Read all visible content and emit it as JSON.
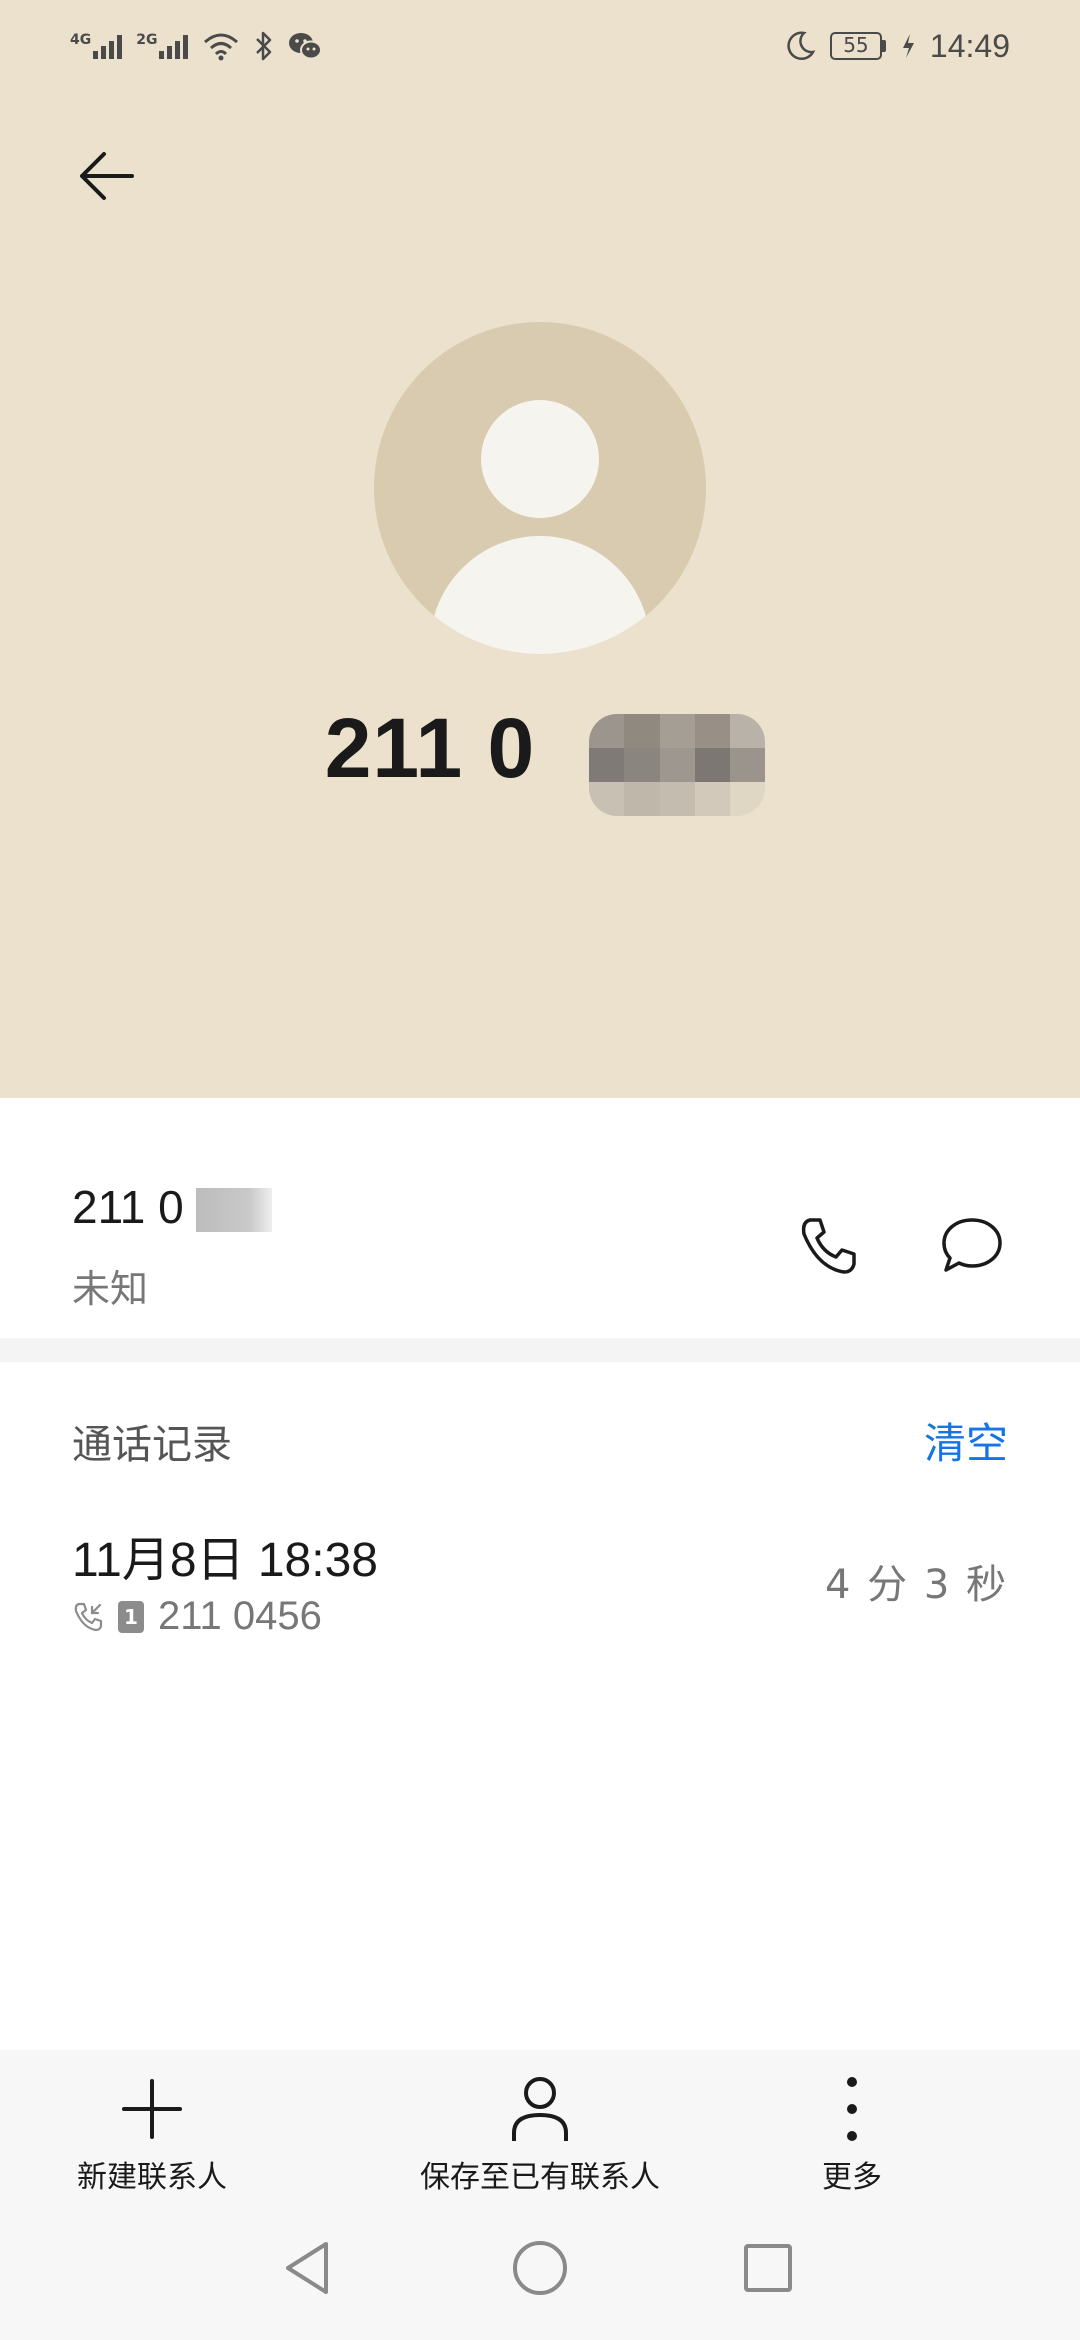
{
  "status_bar": {
    "net1": "4G",
    "net2": "2G",
    "battery": "55",
    "time": "14:49"
  },
  "header": {
    "number_visible": "211 0"
  },
  "contact": {
    "number_visible": "211 0",
    "label": "未知"
  },
  "call_log": {
    "title": "通话记录",
    "clear_label": "清空",
    "items": [
      {
        "datetime": "11月8日 18:38",
        "sim": "1",
        "number": "211 0456",
        "duration": "4 分 3 秒"
      }
    ]
  },
  "toolbar": {
    "new_contact_label": "新建联系人",
    "save_existing_label": "保存至已有联系人",
    "more_label": "更多"
  },
  "colors": {
    "header_bg": "#ebe1cc",
    "avatar_bg": "#d8cbaf",
    "accent": "#1574e6"
  },
  "icons": {
    "back": "arrow-left-icon",
    "call": "phone-icon",
    "message": "chat-bubble-icon",
    "add": "plus-icon",
    "person": "person-icon",
    "more": "more-vertical-icon"
  }
}
